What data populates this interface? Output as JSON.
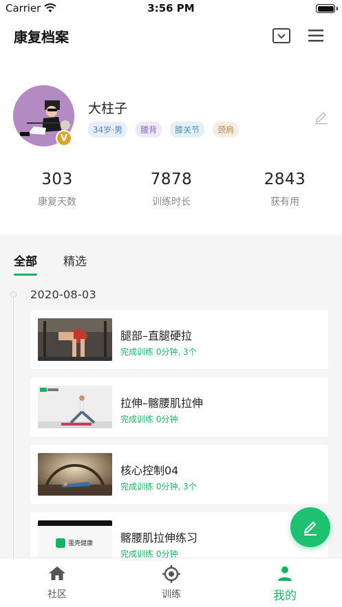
{
  "status_bar": {
    "carrier": "Carrier",
    "time": "3:56 PM"
  },
  "navbar": {
    "title": "康复档案"
  },
  "profile": {
    "name": "大柱子",
    "badge": "V",
    "tags": [
      {
        "label": "34岁·男",
        "color": "#5b7fb5",
        "bg": "#e6eef8"
      },
      {
        "label": "腰背",
        "color": "#8a6bc0",
        "bg": "#eee8f7"
      },
      {
        "label": "膝关节",
        "color": "#4f8fb8",
        "bg": "#e4f0f7"
      },
      {
        "label": "颈肩",
        "color": "#b58a55",
        "bg": "#f6ede2"
      }
    ]
  },
  "stats": [
    {
      "value": "303",
      "label": "康复天数"
    },
    {
      "value": "7878",
      "label": "训练时长"
    },
    {
      "value": "2843",
      "label": "获有用"
    }
  ],
  "tabs": [
    {
      "label": "全部",
      "active": true
    },
    {
      "label": "精选",
      "active": false
    }
  ],
  "timeline": {
    "date": "2020-08-03",
    "items": [
      {
        "title": "腿部–直腿硬拉",
        "subtitle": "完成训练 0分钟, 3个"
      },
      {
        "title": "拉伸–髂腰肌拉伸",
        "subtitle": "完成训练 0分钟"
      },
      {
        "title": "核心控制04",
        "subtitle": "完成训练 0分钟, 3个"
      },
      {
        "title": "髂腰肌拉伸练习",
        "subtitle": "完成训练 0分钟",
        "thumb_text": "蛋壳健康"
      }
    ]
  },
  "tabbar": [
    {
      "label": "社区",
      "icon": "home-icon"
    },
    {
      "label": "训练",
      "icon": "target-icon"
    },
    {
      "label": "我的",
      "icon": "person-icon",
      "active": true
    }
  ],
  "colors": {
    "accent": "#1ab166",
    "fab": "#1ec172"
  }
}
